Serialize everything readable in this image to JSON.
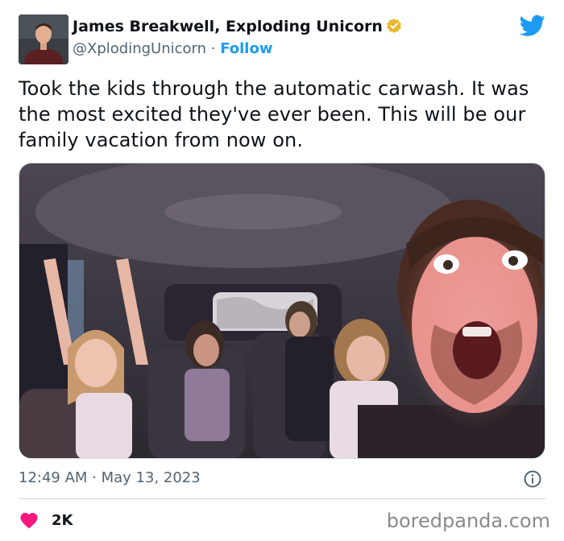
{
  "author": {
    "name": "James Breakwell, Exploding Unicorn",
    "handle": "@XplodingUnicorn",
    "separator": " · ",
    "follow_label": "Follow",
    "verified_color": "#e8b730"
  },
  "brand": {
    "icon": "twitter-bird-icon",
    "color": "#1d9bf0"
  },
  "tweet": {
    "text": "Took the kids through the automatic carwash. It was the most excited they've ever been. This will be our family vacation from now on.",
    "timestamp": "12:49 AM · May 13, 2023"
  },
  "media": {
    "description_icon": "photo"
  },
  "engagement": {
    "like_count": "2K",
    "like_color": "#f91880"
  },
  "watermark": "boredpanda.com"
}
